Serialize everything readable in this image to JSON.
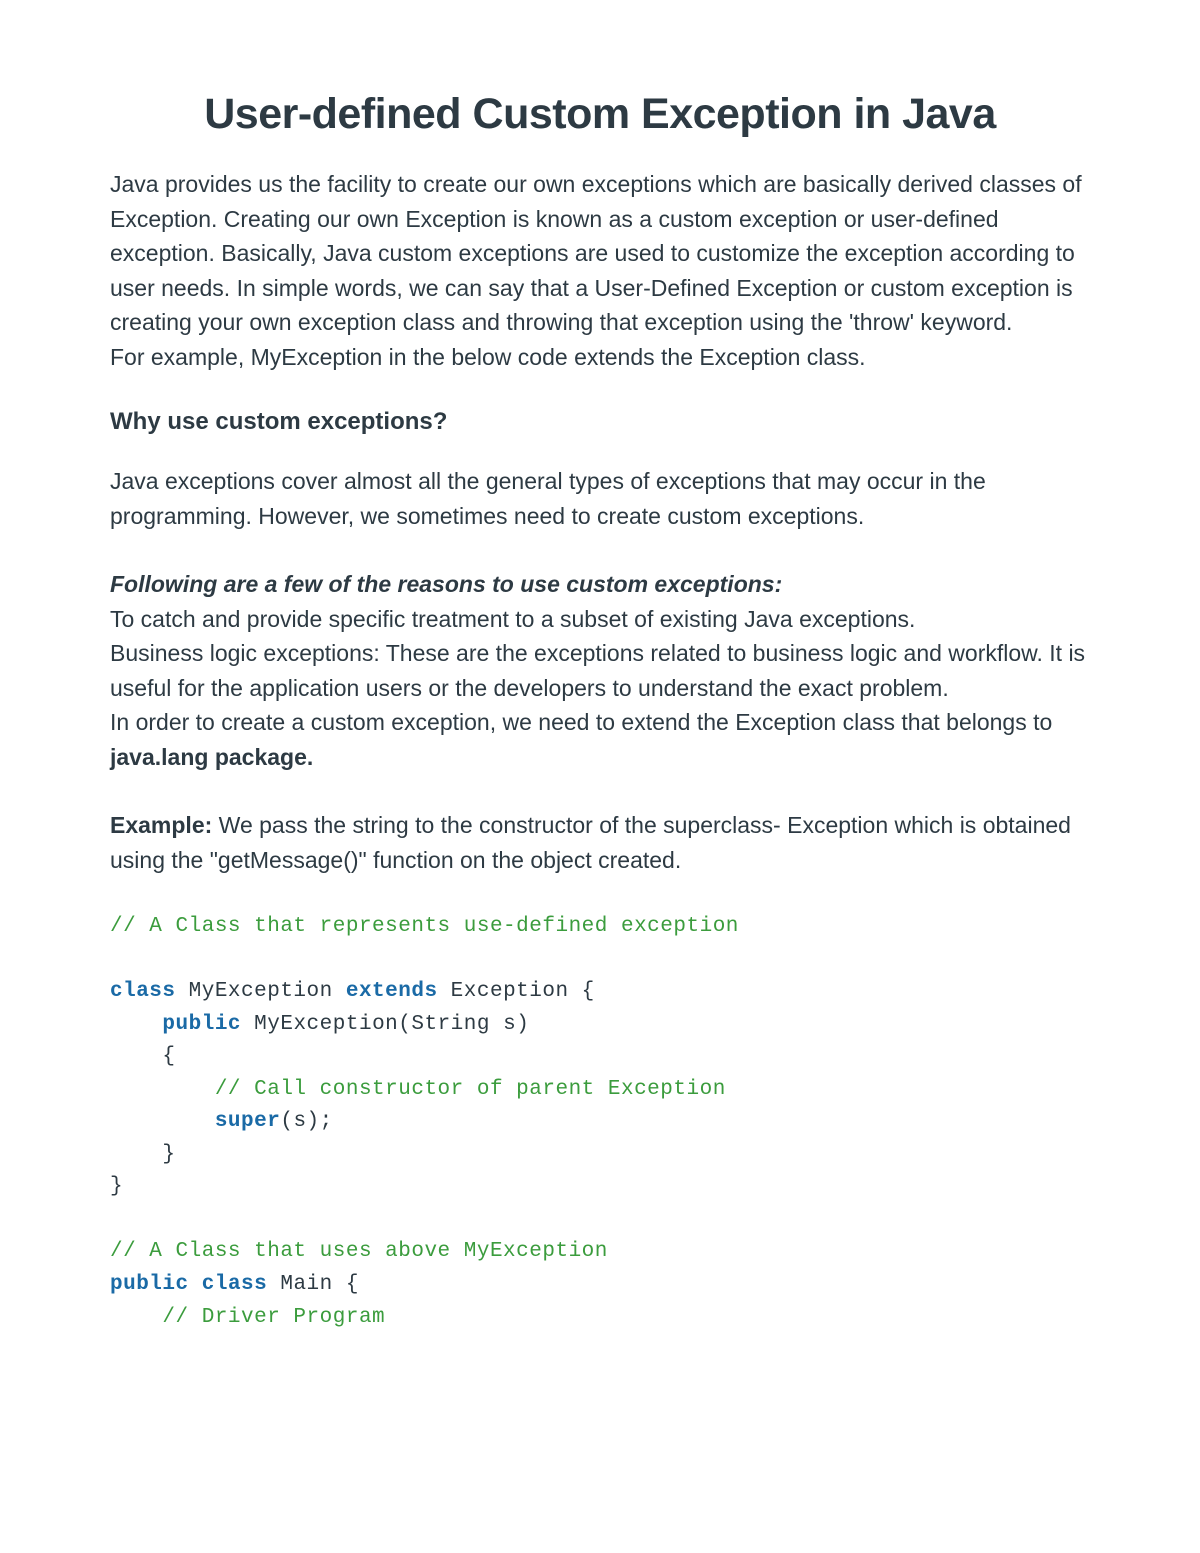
{
  "title": "User-defined Custom Exception in Java",
  "intro_para": "Java provides us the facility to create our own exceptions which are basically derived classes of Exception. Creating our own Exception is known as a custom exception or user-defined exception. Basically, Java custom exceptions are used to customize the exception according to user needs. In simple words, we can say that a User-Defined Exception or custom exception is creating your own exception class and throwing that exception using the 'throw' keyword.\nFor example, MyException in the below code extends the Exception class.",
  "section_why_title": "Why use custom exceptions?",
  "why_para": "Java exceptions cover almost all the general types of exceptions that may occur in the programming. However, we sometimes need to create custom exceptions.",
  "reasons_heading": "Following are a few of the reasons to use custom exceptions:",
  "reasons_body_a": "To catch and provide specific treatment to a subset of existing Java exceptions.\nBusiness logic exceptions: These are the exceptions related to business logic and workflow. It is useful for the application users or the developers to understand the exact problem.\nIn order to create a custom exception, we need to extend the Exception class that belongs to ",
  "reasons_bold": "java.lang package.",
  "example_label": "Example:",
  "example_body": " We pass the string to the constructor of the superclass- Exception which is obtained using the \"getMessage()\" function on the object created.",
  "code": {
    "l1": "// A Class that represents use-defined exception",
    "kw_class": "class",
    "kw_extends": "extends",
    "kw_public": "public",
    "kw_super": "super",
    "name_myexception": " MyException ",
    "name_exception_open": " Exception {",
    "ctor_sig": " MyException(String s)",
    "open_brace": "    {",
    "l_ctor_comment": "        // Call constructor of parent Exception",
    "super_args": "(s);",
    "close_brace_inner": "    }",
    "close_brace_outer": "}",
    "l2_comment": "// A Class that uses above MyException",
    "main_sig": " Main {",
    "driver_comment": "    // Driver Program"
  }
}
